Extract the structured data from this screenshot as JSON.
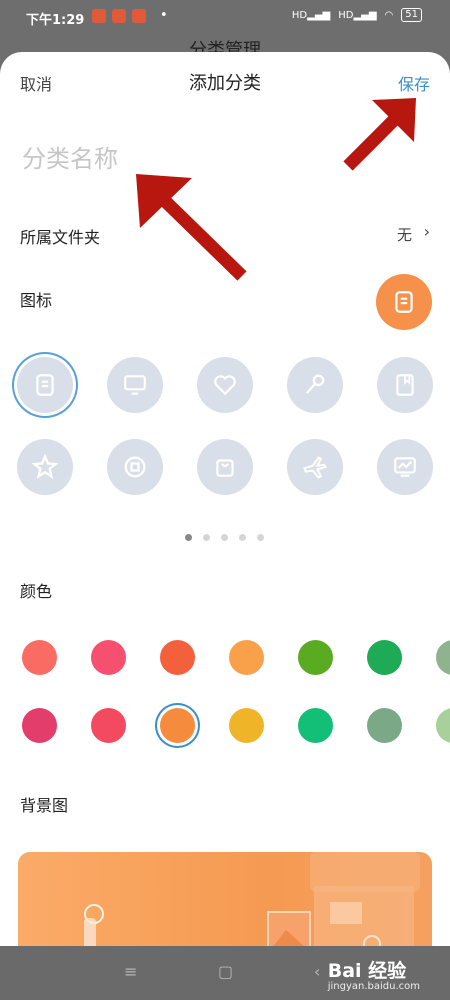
{
  "status_bar": {
    "time": "下午1:29",
    "battery": "51",
    "network_1": "HD",
    "network_2": "HD"
  },
  "background_page": {
    "title": "分类管理"
  },
  "header": {
    "cancel": "取消",
    "title": "添加分类",
    "save": "保存"
  },
  "name_input": {
    "placeholder": "分类名称",
    "value": ""
  },
  "folder_row": {
    "label": "所属文件夹",
    "value": "无"
  },
  "icon_section": {
    "label": "图标",
    "selected_icon": "note-icon",
    "icons": [
      "note-icon",
      "monitor-icon",
      "heart-icon",
      "microphone-icon",
      "bookmark-icon",
      "star-icon",
      "coin-icon",
      "bag-icon",
      "airplane-icon",
      "chart-icon"
    ],
    "page_count": 5,
    "current_page": 1
  },
  "color_section": {
    "label": "颜色",
    "selected_color": "#f58b3c",
    "colors_row1": [
      "#f96b63",
      "#f5506f",
      "#f2603c",
      "#f8a14a",
      "#5aab22",
      "#1faa55",
      "#8fb38f"
    ],
    "colors_row2": [
      "#e23d6b",
      "#f44a60",
      "#f58b3c",
      "#f0b428",
      "#13bf77",
      "#7ba988",
      "#a8d09a"
    ]
  },
  "background_section": {
    "label": "背景图"
  },
  "watermark": {
    "brand": "Bai 经验",
    "url": "jingyan.baidu.com"
  }
}
